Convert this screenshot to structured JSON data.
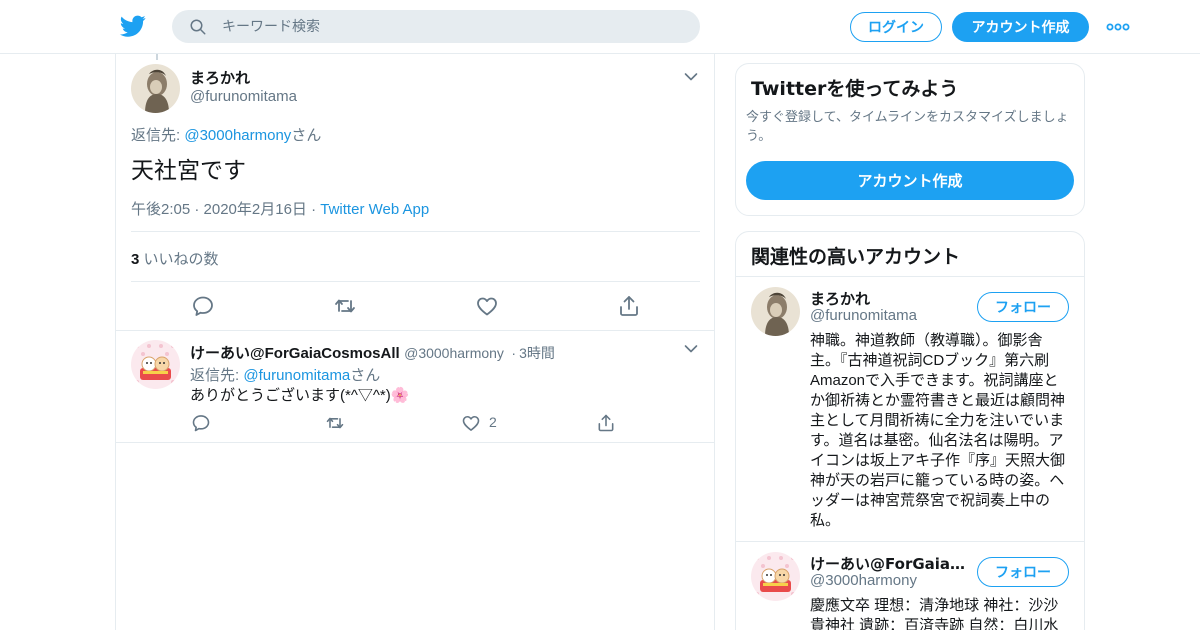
{
  "colors": {
    "brand": "#1da1f2",
    "link": "#1b95e0",
    "muted": "#657786",
    "border": "#e6ecf0",
    "text": "#14171a"
  },
  "header": {
    "logo_icon": "twitter-bird-icon",
    "search_placeholder": "キーワード検索",
    "login_label": "ログイン",
    "signup_label": "アカウント作成",
    "more_icon": "more-dots-icon"
  },
  "tweet": {
    "author_name": "まろかれ",
    "author_handle": "@furunomitama",
    "reply_prefix": "返信先: ",
    "reply_to": "@3000harmony",
    "reply_suffix": "さん",
    "text": "天社宮です",
    "time": "午後2:05 · 2020年2月16日",
    "meta_sep": "·",
    "source": "Twitter Web App",
    "likes_count": "3",
    "likes_label": " いいねの数",
    "actions": [
      "reply-icon",
      "retweet-icon",
      "like-icon",
      "share-icon"
    ]
  },
  "reply": {
    "author_name": "けーあい@ForGaiaCosmosAll",
    "author_handle": "@3000harmony",
    "dot": "·",
    "time_ago": "3時間",
    "reply_prefix": "返信先: ",
    "reply_to": "@furunomitama",
    "reply_suffix": "さん",
    "text": "ありがとうございます(*^▽^*)🌸",
    "like_count": "2"
  },
  "sidebar": {
    "promo": {
      "title": "Twitterを使ってみよう",
      "description": "今すぐ登録して、タイムラインをカスタマイズしましょう。",
      "button": "アカウント作成"
    },
    "related": {
      "title": "関連性の高いアカウント",
      "accounts": [
        {
          "name": "まろかれ",
          "handle": "@furunomitama",
          "follow": "フォロー",
          "bio": "神職。神道教師（教導職）。御影舎主。『古神道祝詞CDブック』第六刷Amazonで入手できます。祝詞講座とか御祈祷とか霊符書きと最近は顧問神主として月間祈祷に全力を注いでいます。道名は基密。仙名法名は陽明。アイコンは坂上アキ子作『序』天照大御神が天の岩戸に籠っている時の姿。ヘッダーは神宮荒祭宮で祝詞奏上中の私。"
        },
        {
          "name": "けーあい@ForGaiaC…",
          "handle": "@3000harmony",
          "follow": "フォロー",
          "bio": "慶應文卒 理想：清浄地球 神社：沙沙貴神社 遺跡：百済寺跡 自然：白川水"
        }
      ]
    }
  }
}
